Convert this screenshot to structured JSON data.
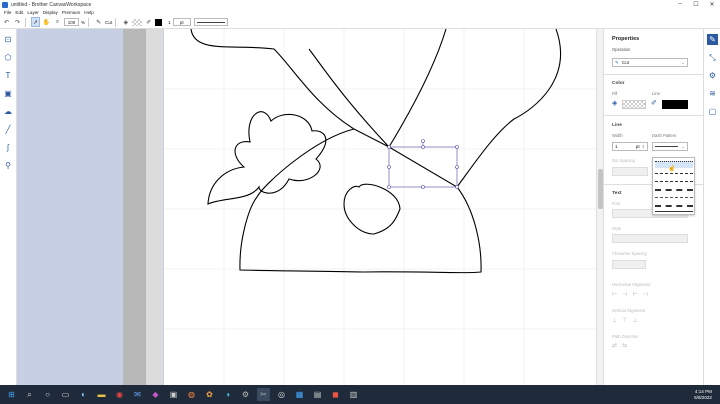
{
  "window": {
    "title": "untitled - Brother CanvasWorkspace",
    "min": "–",
    "max": "☐",
    "close": "✕"
  },
  "menu": [
    "File",
    "Edit",
    "Layer",
    "Display",
    "Premium",
    "Help"
  ],
  "toolbar": {
    "zoom_value": "100",
    "zoom_unit": "%",
    "operation": "Cut",
    "line_width": "1",
    "line_unit": "pt"
  },
  "properties": {
    "title": "Properties",
    "operation_label": "Operation",
    "operation_value": "Cut",
    "color_section": "Color",
    "fill_label": "Fill",
    "line_label": "Line",
    "line_section": "Line",
    "width_label": "Width",
    "width_value": "1",
    "width_unit": "pt",
    "dash_label": "Dash Pattern",
    "dot_spacing_label": "Dot Spacing",
    "text_section": "Text",
    "font_label": "Font",
    "style_label": "Style",
    "char_spacing_label": "Character Spacing",
    "h_align_label": "Horizontal Alignment",
    "v_align_label": "Vertical Alignment",
    "path_dir_label": "Path Direction"
  },
  "taskbar": {
    "time": "4:14 PM",
    "date": "5/8/2022"
  },
  "colors": {
    "accent": "#2c5aa0",
    "workspace": "#c6cfe3",
    "taskbar": "#1f2b3a",
    "line_color": "#000000"
  }
}
